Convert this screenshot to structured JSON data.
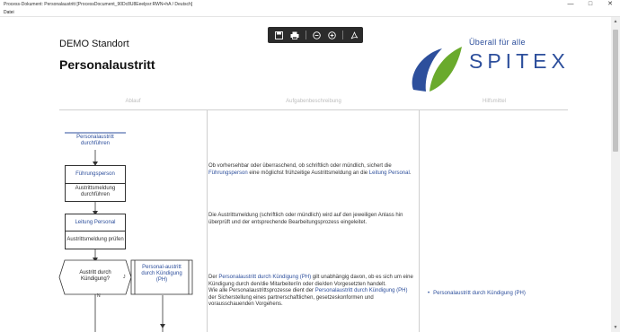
{
  "window": {
    "title": "Process-Dokument: Personalaustritt [ProcessDocument_90Dc8U8Eeelpsr:RWN+hA / Deutsch]",
    "min_glyph": "—",
    "max_glyph": "□",
    "close_glyph": "✕"
  },
  "menubar": {
    "item": "Datei"
  },
  "document": {
    "subtitle": "DEMO Standort",
    "title": "Personalaustritt",
    "columns": {
      "c1": "Ablauf",
      "c2": "Aufgabenbeschreibung",
      "c3": "Hilfsmittel"
    }
  },
  "logo": {
    "tagline": "Überall für alle",
    "name": "SPITEX"
  },
  "flow": {
    "start": "Personalaustritt durchführen",
    "box1": {
      "role": "Führungsperson",
      "task": "Austrittsmeldung durchführen"
    },
    "box2": {
      "role": "Leitung Personal",
      "task": "Austrittsmeldung prüfen"
    },
    "decision": "Austritt durch Kündigung?",
    "subprocess": "Personal-austritt durch Kündigung (PH)",
    "yes": "J",
    "no": "N"
  },
  "descriptions": {
    "d1_a": "Ob vorhersehbar oder überraschend, ob schriftlich oder mündlich, sichert die ",
    "d1_link": "Führungsperson",
    "d1_b": " eine möglichst frühzeitige Austrittsmeldung an die ",
    "d1_link2": "Leitung Personal",
    "d1_c": ".",
    "d2": "Die Austrittsmeldung (schriftlich oder mündlich) wird auf den jeweiligen Anlass hin überprüft und der entsprechende Bearbeitungsprozess eingeleitet.",
    "d3_a": "Der ",
    "d3_link": "Personalaustritt durch Kündigung (PH)",
    "d3_b": " gilt unabhängig davon, ob es sich um eine Kündigung durch den/die Mitarbeiter/in oder die/den Vorgesetzten handelt.",
    "d3_c": "Wie alle Personalaustrittsprozesse dient der ",
    "d3_link2": "Personalaustritt durch Kündigung (PH)",
    "d3_d": " der Sicherstellung eines partnerschaftlichen, gesetzeskonformen und vorausschauenden Vorgehens."
  },
  "aids": {
    "item1": "Personalaustritt durch Kündigung (PH)"
  },
  "toolbar": {
    "save": "save-icon",
    "print": "print-icon",
    "zoom_out": "zoom-out-icon",
    "zoom_in": "zoom-in-icon",
    "pdf": "pdf-icon"
  }
}
